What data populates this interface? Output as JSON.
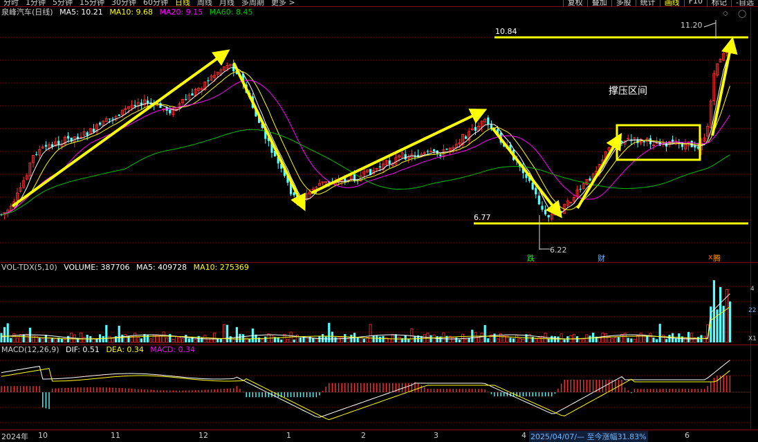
{
  "toolbar": {
    "periods": [
      "分时",
      "1分钟",
      "5分钟",
      "15分钟",
      "30分钟",
      "60分钟",
      "日线",
      "周线",
      "月线",
      "多周期",
      "更多 >"
    ],
    "active_period": "日线",
    "right_buttons": [
      "复权",
      "叠加",
      "多股",
      "统计",
      "画线",
      "F10",
      "标记",
      "-自选"
    ],
    "active_right": "画线"
  },
  "price_header": {
    "stock": "泉峰汽车(日线)",
    "ma5": "MA5: 10.21",
    "ma10": "MA10: 9.68",
    "ma20": "MA20: 9.15",
    "ma60": "MA60: 8.45"
  },
  "vol_header": {
    "name": "VOL-TDX(5,10)",
    "volume": "VOLUME: 387706",
    "ma5": "MA5: 409728",
    "ma10": "MA10: 275369"
  },
  "macd_header": {
    "name": "MACD(12,26,9)",
    "dif": "DIF: 0.51",
    "dea": "DEA: 0.34",
    "macd": "MACD: 0.34"
  },
  "annotations": {
    "level_high": "10.84",
    "level_low": "6.77",
    "peak": "11.20",
    "trough": "6.22",
    "zone": "撑压区间",
    "marker_die": "跌",
    "marker_cai": "财",
    "marker_teng": "腾",
    "marker_x": "x"
  },
  "vol_axis": {
    "v1": "4",
    "v2": "22",
    "v3": "X1"
  },
  "time_axis": {
    "labels": [
      "2024年",
      "10",
      "11",
      "12",
      "1",
      "2",
      "3",
      "4",
      "6"
    ],
    "range_info": "2025/04/07/— 至今涨幅31.83%"
  },
  "colors": {
    "up": "#ff3232",
    "down": "#54ffff",
    "ma5": "#ffffff",
    "ma10": "#ffff00",
    "ma20": "#ff00ff",
    "ma60": "#00c000",
    "arrow": "#ffff00",
    "grid": "#8b0000"
  },
  "chart_data": {
    "type": "candlestick",
    "period": "daily",
    "trend_segments": [
      {
        "from_month": "2024-09",
        "to_month": "2024-12",
        "direction": "up"
      },
      {
        "from_month": "2024-12",
        "to_month": "2025-01",
        "direction": "down"
      },
      {
        "from_month": "2025-01",
        "to_month": "2025-03",
        "direction": "up"
      },
      {
        "from_month": "2025-03",
        "to_month": "2025-04",
        "direction": "down"
      },
      {
        "from_month": "2025-04",
        "to_month": "2025-05",
        "direction": "up"
      },
      {
        "from_month": "2025-05",
        "to_month": "2025-06",
        "direction": "sideways"
      },
      {
        "from_month": "2025-06",
        "to_month": "2025-06",
        "direction": "up"
      }
    ],
    "levels": {
      "resistance": 10.84,
      "support": 6.77,
      "high": 11.2,
      "low": 6.22
    }
  }
}
